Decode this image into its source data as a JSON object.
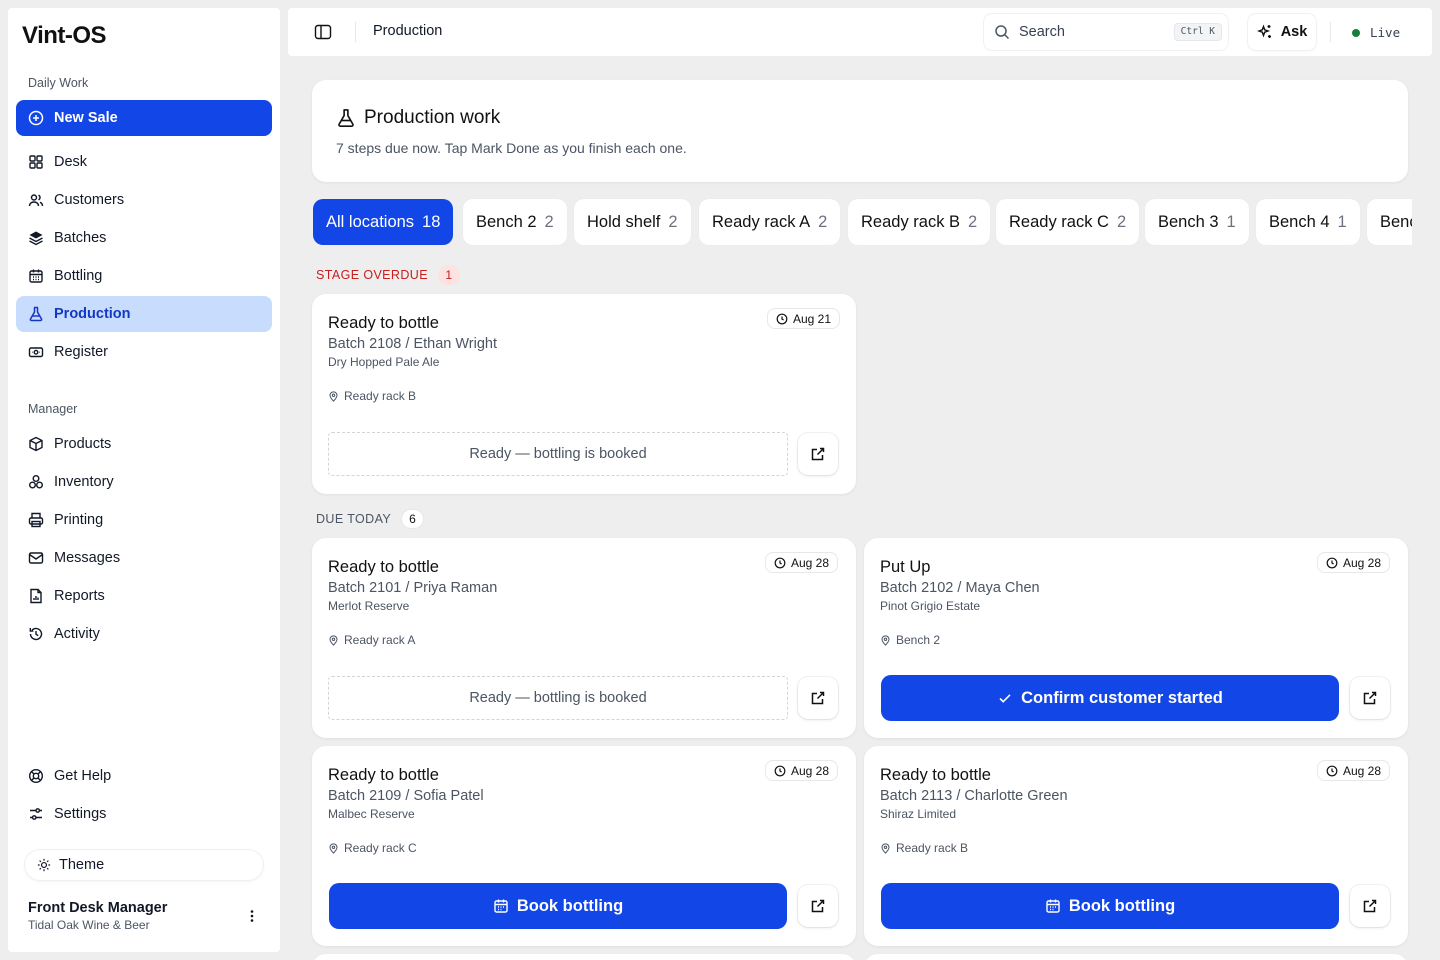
{
  "app": {
    "logo": "Vint-OS"
  },
  "sidebar": {
    "section_daily": "Daily Work",
    "section_manager": "Manager",
    "new_sale": "New Sale",
    "daily_items": [
      {
        "label": "Desk",
        "icon": "grid-icon"
      },
      {
        "label": "Customers",
        "icon": "users-icon"
      },
      {
        "label": "Batches",
        "icon": "layers-icon"
      },
      {
        "label": "Bottling",
        "icon": "calendar-icon"
      },
      {
        "label": "Production",
        "icon": "flask-icon",
        "active": true
      },
      {
        "label": "Register",
        "icon": "cash-icon"
      }
    ],
    "manager_items": [
      {
        "label": "Products",
        "icon": "box-icon"
      },
      {
        "label": "Inventory",
        "icon": "stack-icon"
      },
      {
        "label": "Printing",
        "icon": "printer-icon"
      },
      {
        "label": "Messages",
        "icon": "mail-icon"
      },
      {
        "label": "Reports",
        "icon": "report-icon"
      },
      {
        "label": "Activity",
        "icon": "history-icon"
      }
    ],
    "footer_items": [
      {
        "label": "Get Help",
        "icon": "lifebuoy-icon"
      },
      {
        "label": "Settings",
        "icon": "sliders-icon"
      }
    ],
    "theme_label": "Theme",
    "user": {
      "name": "Front Desk Manager",
      "org": "Tidal Oak Wine & Beer"
    }
  },
  "topbar": {
    "breadcrumb": "Production",
    "search_placeholder": "Search",
    "search_shortcut": "Ctrl K",
    "ask_label": "Ask",
    "live_label": "Live",
    "live_color": "#15803d"
  },
  "header": {
    "title": "Production work",
    "subtitle": "7 steps due now. Tap Mark Done as you finish each one."
  },
  "filters": [
    {
      "label": "All locations",
      "count": "18",
      "selected": true
    },
    {
      "label": "Bench 2",
      "count": "2"
    },
    {
      "label": "Hold shelf",
      "count": "2"
    },
    {
      "label": "Ready rack A",
      "count": "2"
    },
    {
      "label": "Ready rack B",
      "count": "2"
    },
    {
      "label": "Ready rack C",
      "count": "2"
    },
    {
      "label": "Bench 3",
      "count": "1"
    },
    {
      "label": "Bench 4",
      "count": "1"
    },
    {
      "label": "Bench",
      "count": ""
    }
  ],
  "groups": {
    "overdue": {
      "label": "STAGE OVERDUE",
      "count": "1"
    },
    "today": {
      "label": "DUE TODAY",
      "count": "6"
    }
  },
  "cards": [
    {
      "title": "Ready to bottle",
      "batch": "Batch 2108 / Ethan Wright",
      "product": "Dry Hopped Pale Ale",
      "location": "Ready rack B",
      "date": "Aug 21",
      "status_text": "Ready — bottling is booked",
      "action": ""
    },
    {
      "title": "Ready to bottle",
      "batch": "Batch 2101 / Priya Raman",
      "product": "Merlot Reserve",
      "location": "Ready rack A",
      "date": "Aug 28",
      "status_text": "Ready — bottling is booked",
      "action": ""
    },
    {
      "title": "Put Up",
      "batch": "Batch 2102 / Maya Chen",
      "product": "Pinot Grigio Estate",
      "location": "Bench 2",
      "date": "Aug 28",
      "status_text": "",
      "action": "Confirm customer started"
    },
    {
      "title": "Ready to bottle",
      "batch": "Batch 2109 / Sofia Patel",
      "product": "Malbec Reserve",
      "location": "Ready rack C",
      "date": "Aug 28",
      "status_text": "",
      "action": "Book bottling"
    },
    {
      "title": "Ready to bottle",
      "batch": "Batch 2113 / Charlotte Green",
      "product": "Shiraz Limited",
      "location": "Ready rack B",
      "date": "Aug 28",
      "status_text": "",
      "action": "Book bottling"
    }
  ],
  "colors": {
    "accent": "#1346e6",
    "active_bg": "#c8dcfd",
    "overdue": "#c81e1e"
  }
}
